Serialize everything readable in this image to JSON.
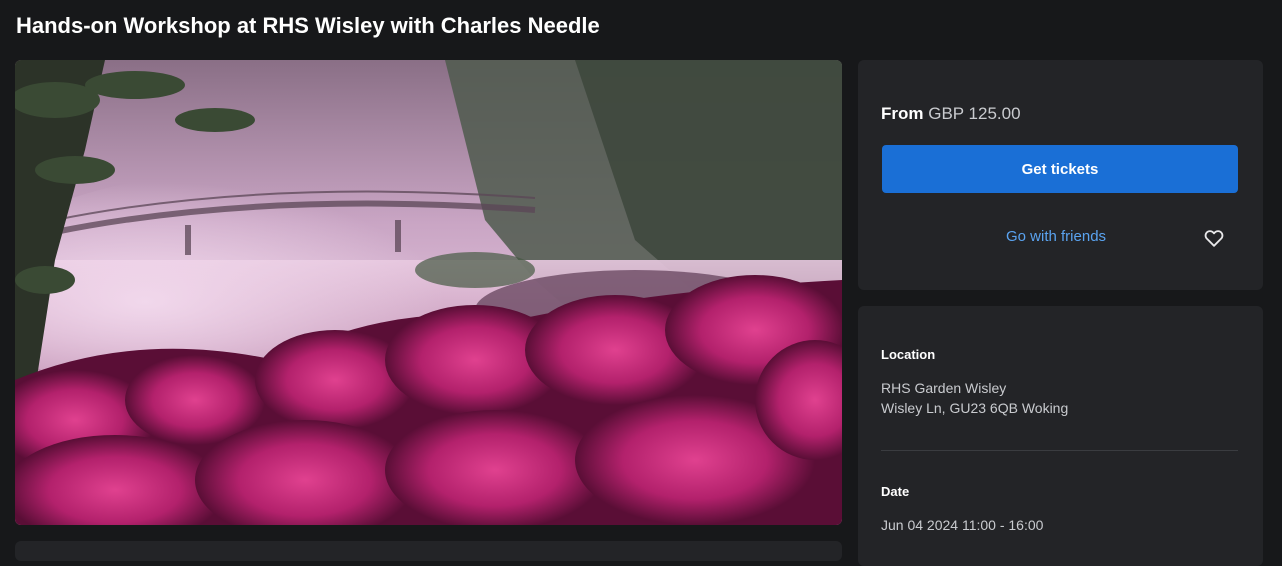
{
  "event": {
    "title": "Hands-on Workshop at RHS Wisley with Charles Needle"
  },
  "tickets": {
    "price_prefix": "From",
    "price_value": "GBP 125.00",
    "get_tickets_label": "Get tickets",
    "go_with_friends_label": "Go with friends",
    "favorite_icon": "heart-outline"
  },
  "details": {
    "location_label": "Location",
    "venue_name": "RHS Garden Wisley",
    "venue_address": "Wisley Ln, GU23 6QB Woking",
    "date_label": "Date",
    "date_value": "Jun 04 2024 11:00 - 16:00"
  },
  "colors": {
    "background": "#17181a",
    "card": "#232427",
    "accent_button": "#1a6fd6",
    "link": "#5aa3f0"
  }
}
